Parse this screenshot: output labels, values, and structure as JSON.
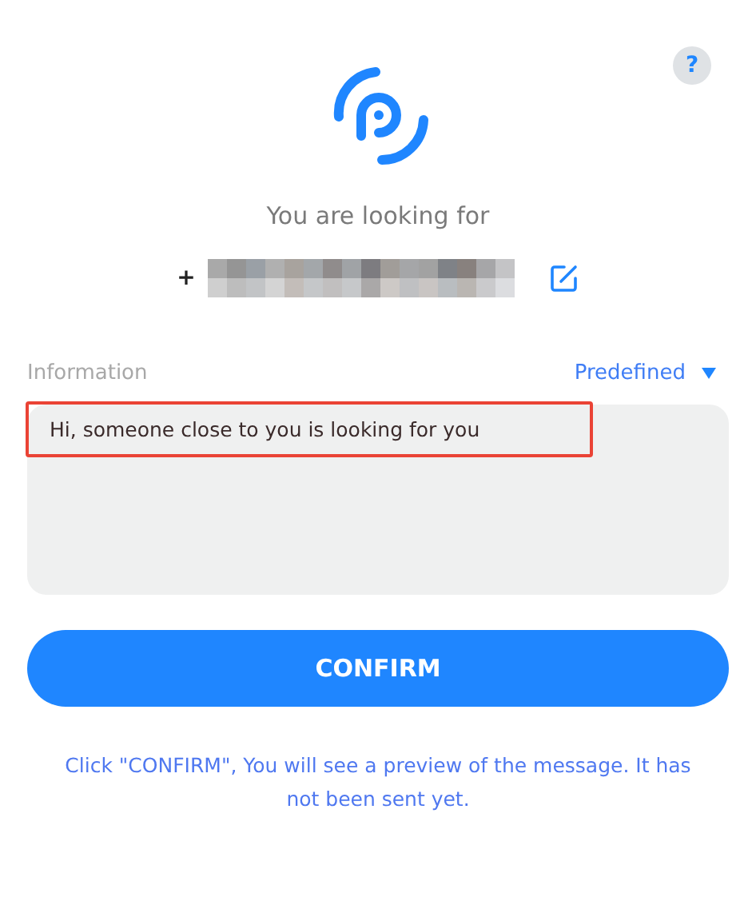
{
  "help_button": {
    "label": "?"
  },
  "heading": "You are looking for",
  "recipient": {
    "prefix": "+"
  },
  "information": {
    "label": "Information",
    "mode": "Predefined",
    "message": "Hi, someone close to you is looking for you",
    "highlighted": true
  },
  "confirm_button": {
    "label": "CONFIRM"
  },
  "note": "Click \"CONFIRM\", You will see a preview of the message. It has not been sent yet."
}
